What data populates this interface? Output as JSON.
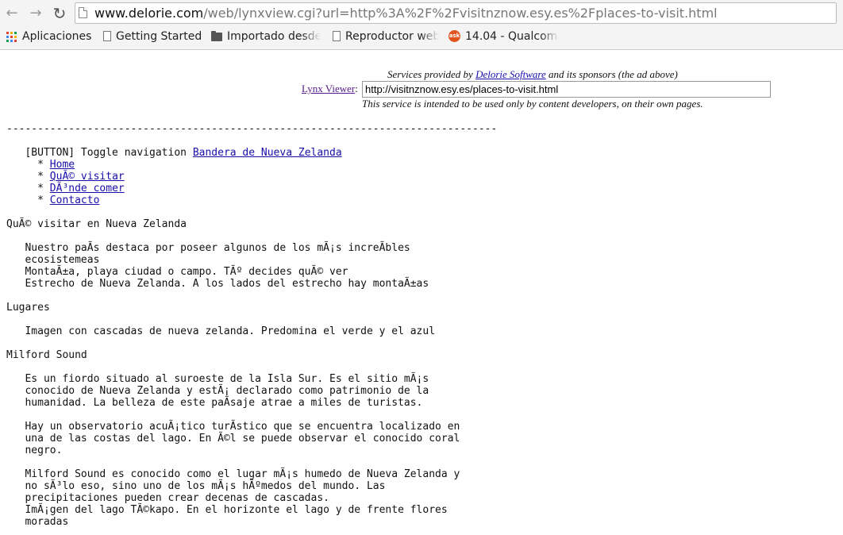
{
  "browser": {
    "url_host": "www.delorie.com",
    "url_rest": "/web/lynxview.cgi?url=http%3A%2F%2Fvisitnznow.esy.es%2Fplaces-to-visit.html",
    "bookmarks": [
      {
        "label": "Aplicaciones",
        "icon": "apps-icon"
      },
      {
        "label": "Getting Started",
        "icon": "page-icon"
      },
      {
        "label": "Importado desde",
        "icon": "folder-icon"
      },
      {
        "label": "Reproductor web",
        "icon": "page-icon"
      },
      {
        "label": "14.04 - Qualcomm",
        "icon": "ask-icon"
      }
    ],
    "ask_icon_text": "ask"
  },
  "header": {
    "services_prefix": "Services provided by ",
    "services_link": "Delorie Software",
    "services_suffix": " and its sponsors (the ad above)",
    "viewer_label": "Lynx Viewer",
    "viewer_colon": ":",
    "viewer_value": "http://visitnznow.esy.es/places-to-visit.html",
    "service_note": "This service is intended to be used only by content developers, on their own pages."
  },
  "content": {
    "divider": "-------------------------------------------------------------------------------",
    "button_text": "   [BUTTON] Toggle navigation ",
    "brand_link": "Bandera de Nueva Zelanda",
    "nav_bullet": "     * ",
    "nav": [
      "Home",
      "QuÃ© visitar",
      "DÃ³nde comer",
      "Contacto"
    ],
    "heading": "QuÃ© visitar en Nueva Zelanda",
    "intro": "   Nuestro paÃs destaca por poseer algunos de los mÃ¡s increÃbles\n   ecosistemeas\n   MontaÃ±a, playa ciudad o campo. TÃº decides quÃ© ver\n   Estrecho de Nueva Zelanda. A los lados del estrecho hay montaÃ±as",
    "lugares": "Lugares",
    "lugares_img": "   Imagen con cascadas de nueva zelanda. Predomina el verde y el azul",
    "milford_title": "Milford Sound",
    "milford_p1": "   Es un fiordo situado al suroeste de la Isla Sur. Es el sitio mÃ¡s\n   conocido de Nueva Zelanda y estÃ¡ declarado como patrimonio de la\n   humanidad. La belleza de este paÃsaje atrae a miles de turistas.",
    "milford_p2": "   Hay un observatorio acuÃ¡tico turÃstico que se encuentra localizado en\n   una de las costas del lago. En Ã©l se puede observar el conocido coral\n   negro.",
    "milford_p3": "   Milford Sound es conocido como el lugar mÃ¡s humedo de Nueva Zelanda y\n   no sÃ³lo eso, sino uno de los mÃ¡s hÃºmedos del mundo. Las\n   precipitaciones pueden crear decenas de cascadas.\n   ImÃ¡gen del lago TÃ©kapo. En el horizonte el lago y de frente flores\n   moradas"
  }
}
